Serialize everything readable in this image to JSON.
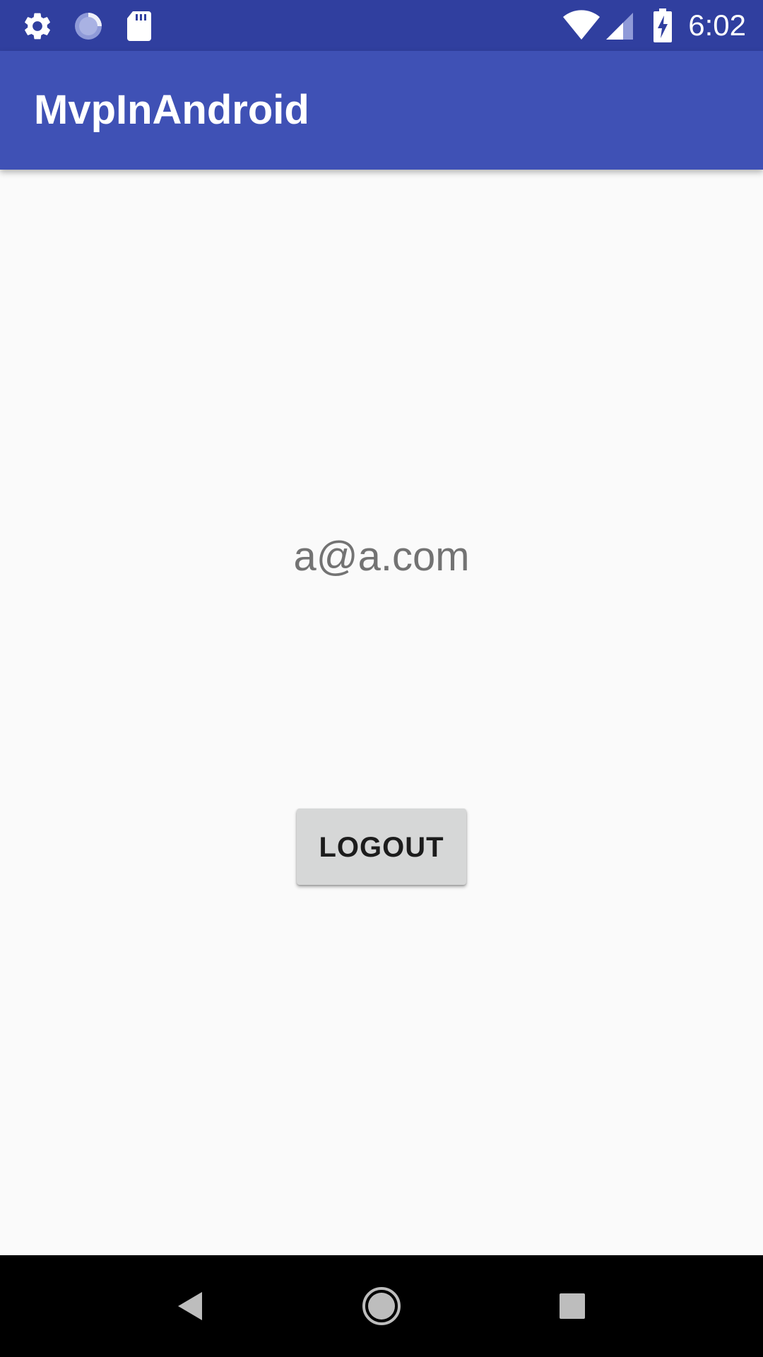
{
  "status_bar": {
    "time": "6:02",
    "icons": [
      "settings-icon",
      "sync-icon",
      "sd-card-icon",
      "wifi-icon",
      "cell-signal-icon",
      "battery-charging-icon"
    ]
  },
  "app_bar": {
    "title": "MvpInAndroid"
  },
  "main": {
    "email": "a@a.com",
    "logout_label": "LOGOUT"
  },
  "nav_bar": {
    "icons": [
      "back-icon",
      "home-icon",
      "recents-icon"
    ]
  },
  "colors": {
    "status_bar": "#303f9f",
    "app_bar": "#3f51b5",
    "background": "#fafafa",
    "button": "#d6d7d7",
    "email_text": "#737373"
  }
}
